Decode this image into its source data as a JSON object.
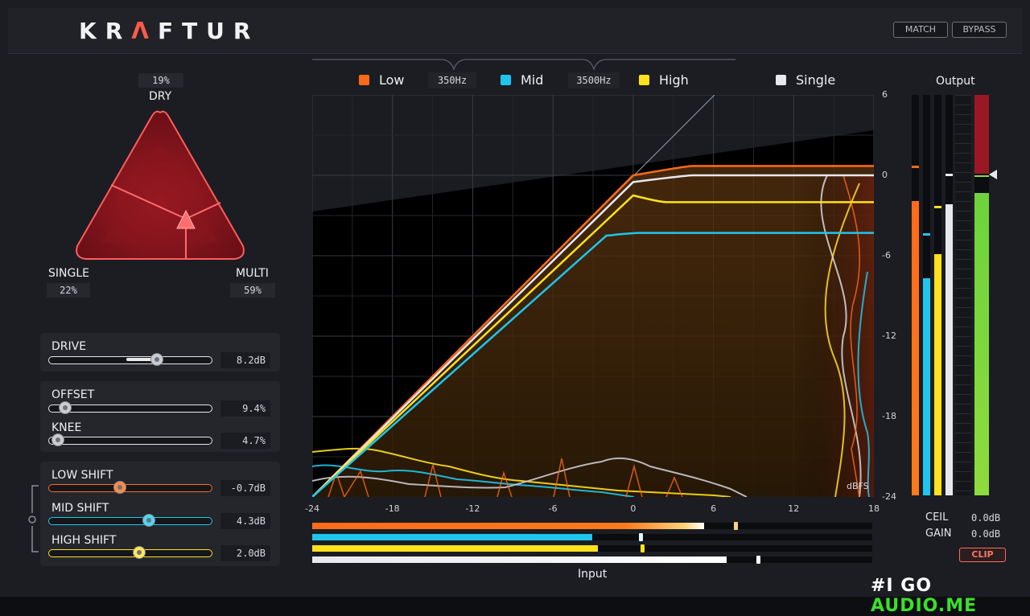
{
  "header": {
    "logo_pre": "KR",
    "logo_mark": "Λ",
    "logo_post": "FTUR",
    "match_label": "MATCH",
    "bypass_label": "BYPASS"
  },
  "mix": {
    "dry_label": "DRY",
    "dry_value": "19%",
    "single_label": "SINGLE",
    "single_value": "22%",
    "multi_label": "MULTI",
    "multi_value": "59%"
  },
  "controls": {
    "drive": {
      "label": "DRIVE",
      "value": "8.2dB",
      "position": 0.67
    },
    "offset": {
      "label": "OFFSET",
      "value": "9.4%",
      "position": 0.1
    },
    "knee": {
      "label": "KNEE",
      "value": "4.7%",
      "position": 0.05
    },
    "low_shift": {
      "label": "LOW SHIFT",
      "value": "-0.7dB",
      "position": 0.44
    },
    "mid_shift": {
      "label": "MID SHIFT",
      "value": "4.3dB",
      "position": 0.62
    },
    "high_shift": {
      "label": "HIGH SHIFT",
      "value": "2.0dB",
      "position": 0.55
    }
  },
  "bands": {
    "low_label": "Low",
    "mid_label": "Mid",
    "high_label": "High",
    "single_label": "Single",
    "crossover_1": "350Hz",
    "crossover_2": "3500Hz"
  },
  "colors": {
    "low": "#ff6a1a",
    "mid": "#1ec6ee",
    "high": "#ffe11c",
    "single": "#e8e8ee",
    "accent": "#ff5a4a"
  },
  "chart_data": {
    "type": "line",
    "xlabel": "Input",
    "ylabel": "dBFS",
    "xlim": [
      -24,
      18
    ],
    "ylim": [
      -24,
      6
    ],
    "x_ticks": [
      "-24",
      "-18",
      "-12",
      "-6",
      "0",
      "6",
      "12",
      "18"
    ],
    "y_ticks": [
      "6",
      "0",
      "-6",
      "-12",
      "-18",
      "-24"
    ],
    "series": [
      {
        "name": "Low",
        "x": [
          -24,
          0,
          4,
          18
        ],
        "y": [
          -24,
          0,
          0.7,
          0.7
        ]
      },
      {
        "name": "Single",
        "x": [
          -24,
          0,
          4,
          18
        ],
        "y": [
          -24,
          -0.5,
          0,
          0
        ]
      },
      {
        "name": "High",
        "x": [
          -24,
          0,
          2,
          18
        ],
        "y": [
          -24,
          -1.5,
          -2,
          -2
        ]
      },
      {
        "name": "Mid",
        "x": [
          -24,
          -2,
          0,
          18
        ],
        "y": [
          -24,
          -4.5,
          -4.3,
          -4.3
        ]
      }
    ]
  },
  "input_meters": {
    "label": "Input",
    "low": 0.7,
    "mid": 0.5,
    "high": 0.51,
    "single": 0.74
  },
  "output": {
    "label": "Output",
    "ceil_label": "CEIL",
    "ceil_value": "0.0dB",
    "gain_label": "GAIN",
    "gain_value": "0.0dB",
    "clip_label": "CLIP"
  },
  "watermark": {
    "pre": "#I GO ",
    "post": "AUDIO.ME"
  }
}
